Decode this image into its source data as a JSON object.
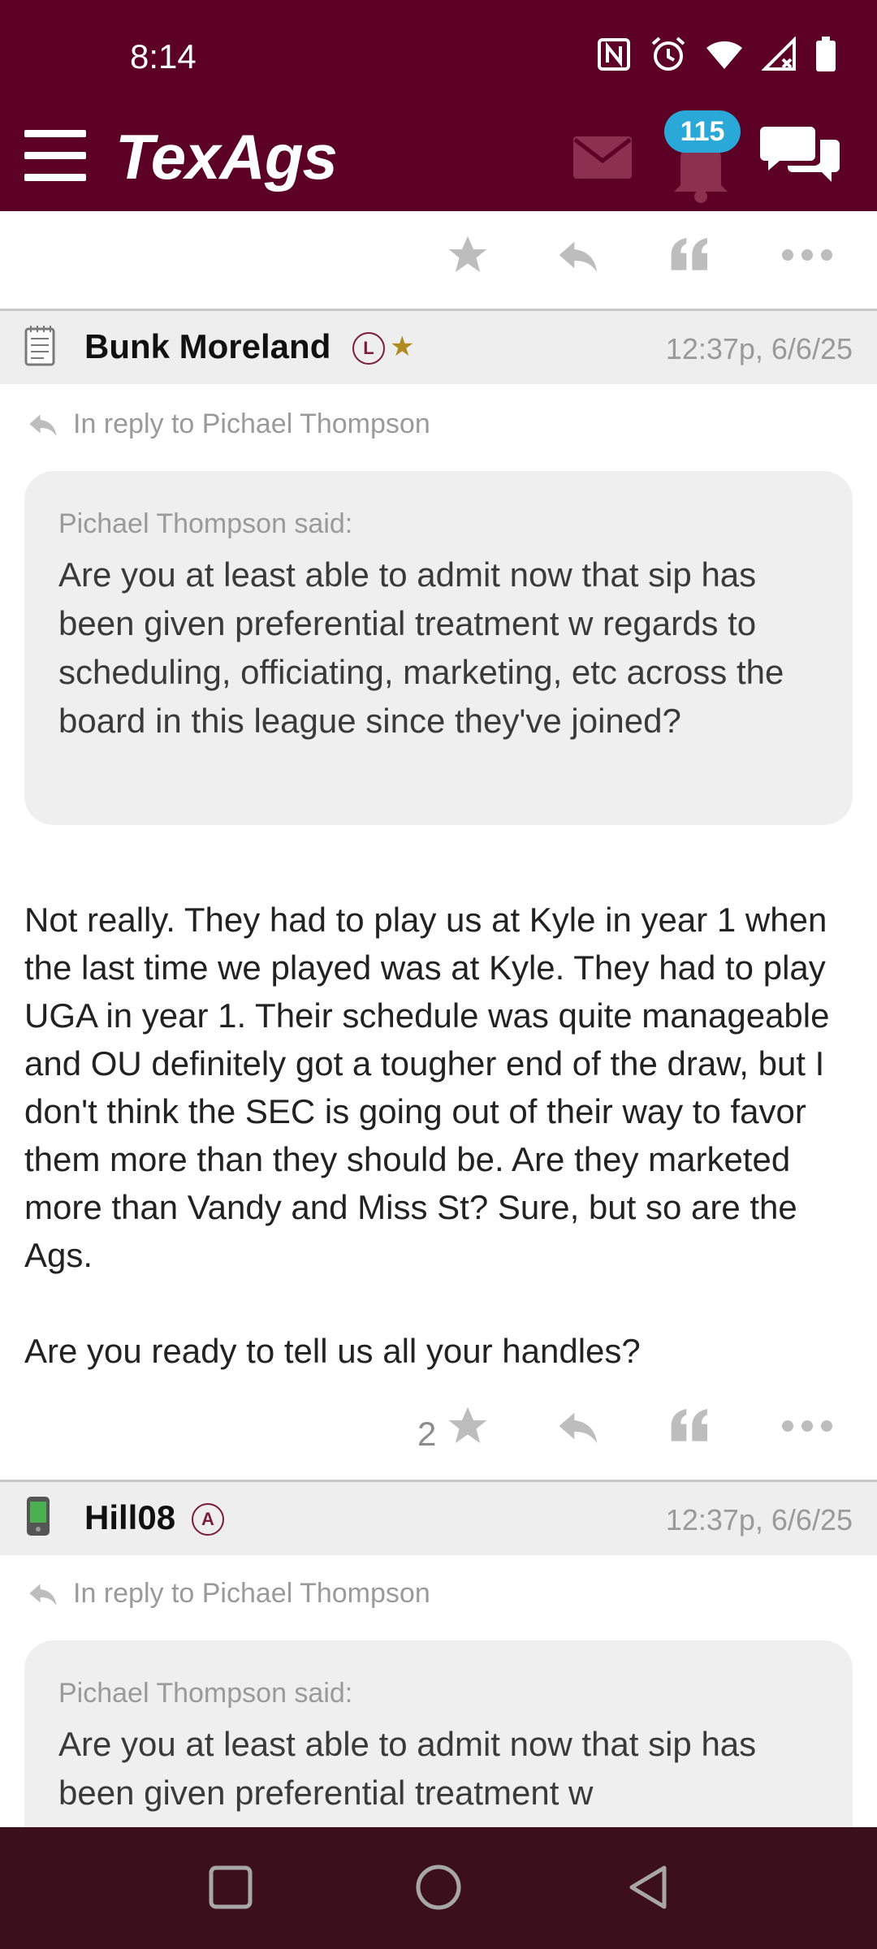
{
  "status_bar": {
    "time": "8:14",
    "icons": [
      "nfc-icon",
      "alarm-icon",
      "wifi-icon",
      "signal-icon",
      "battery-icon"
    ]
  },
  "header": {
    "logo": "TexAgs",
    "notification_count": "115",
    "icons": [
      "menu-icon",
      "mail-icon",
      "bell-icon",
      "chat-icon"
    ]
  },
  "posts": [
    {
      "username": "Bunk Moreland",
      "badge": "L",
      "has_star": true,
      "timestamp": "12:37p, 6/6/25",
      "reply_to": "In reply to Pichael Thompson",
      "quote_author": "Pichael Thompson said:",
      "quote_text": "Are you at least able to admit now that sip has been given preferential treatment w regards to scheduling, officiating, marketing, etc across the board in this league since they've joined?",
      "body_paragraph_1": "Not really. They had to play us at Kyle in year 1 when the last time we played was at Kyle. They had to play UGA in year 1. Their schedule was quite manageable and OU definitely got a tougher end of the draw, but I don't think the SEC is going out of their way to favor them more than they should be. Are they marketed more than Vandy and Miss St? Sure, but so are the Ags.",
      "body_paragraph_2": "Are you ready to tell us all your handles?",
      "star_count": "2"
    },
    {
      "username": "Hill08",
      "badge": "A",
      "has_star": false,
      "timestamp": "12:37p, 6/6/25",
      "reply_to": "In reply to Pichael Thompson",
      "quote_author": "Pichael Thompson said:",
      "quote_text": "Are you at least able to admit now that sip has been given preferential treatment w"
    }
  ],
  "colors": {
    "header_bg": "#5c0025",
    "badge_bg": "#2aa8d8",
    "navbar_bg": "#3b0f1c",
    "star_gold": "#b08a1e"
  }
}
